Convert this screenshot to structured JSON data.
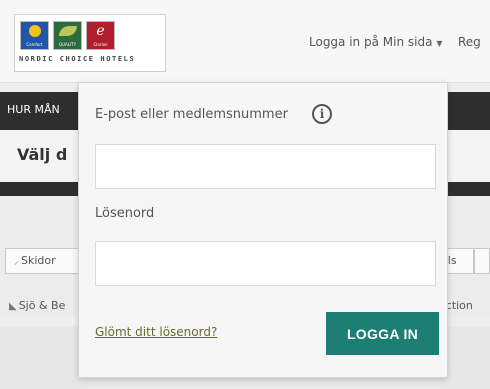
{
  "header": {
    "brand_text": "NORDIC CHOICE HOTELS",
    "logos": [
      {
        "icon": "comfort-logo-icon",
        "name": "Comfort",
        "color": "#1f56a8"
      },
      {
        "icon": "quality-logo-icon",
        "name": "QUALITY",
        "color": "#2d6a3e"
      },
      {
        "icon": "clarion-logo-icon",
        "name": "Clarion",
        "letter": "e",
        "color": "#b01e2e"
      }
    ],
    "login_link": "Logga in på Min sida",
    "login_caret": "▼",
    "register_link_partial": "Reg"
  },
  "nav": {
    "first_item_partial": "HUR MÅN"
  },
  "content": {
    "heading_partial": "Välj d",
    "filters": {
      "skidor": "Skidor",
      "skidor_icon": "ski-icon",
      "ls_partial": "els",
      "sjo_partial": "Sjö & Be",
      "sjo_icon": "lake-icon",
      "ection_partial": "ection"
    }
  },
  "login_dropdown": {
    "email_label": "E-post eller medlemsnummer",
    "info_icon": "info-icon",
    "info_glyph": "i",
    "email_value": "",
    "password_label": "Lösenord",
    "password_value": "",
    "forgot_link": "Glömt ditt lösenord?",
    "submit_label": "LOGGA IN",
    "accent_color": "#1d7e76"
  }
}
